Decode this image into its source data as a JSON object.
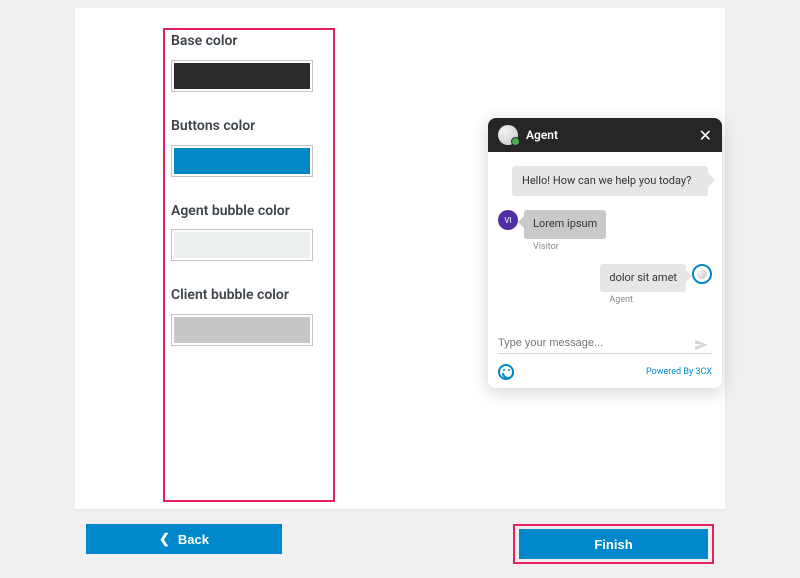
{
  "settings": {
    "base_color_label": "Base color",
    "buttons_color_label": "Buttons color",
    "agent_bubble_label": "Agent bubble color",
    "client_bubble_label": "Client bubble color",
    "colors": {
      "base": "#2b2b2b",
      "buttons": "#0187c8",
      "agent_bubble": "#eceff0",
      "client_bubble": "#c7c7c7"
    }
  },
  "chat": {
    "header_title": "Agent",
    "greeting": "Hello! How can we help you today?",
    "visitor_initials": "VI",
    "visitor_msg": "Lorem ipsum",
    "visitor_label": "Visitor",
    "agent_msg": "dolor sit amet",
    "agent_label": "Agent",
    "input_placeholder": "Type your message...",
    "powered_by": "Powered By 3CX"
  },
  "nav": {
    "back_label": "Back",
    "finish_label": "Finish"
  }
}
